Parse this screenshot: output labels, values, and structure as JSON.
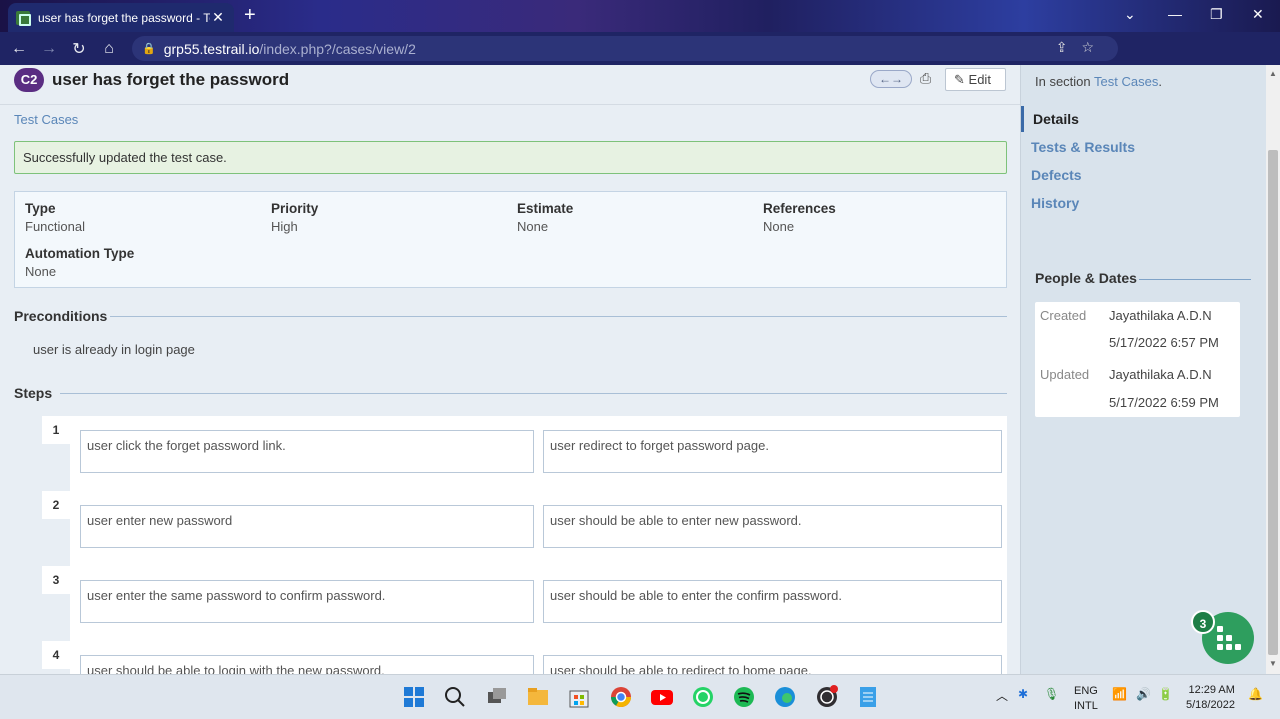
{
  "browser": {
    "tab_title": "user has forget the password - Te",
    "url_host": "grp55.testrail.io",
    "url_path": "/index.php?/cases/view/2"
  },
  "case": {
    "id_badge": "C2",
    "title": "user has forget the password",
    "edit_label": "Edit",
    "breadcrumb": "Test Cases",
    "success_message": "Successfully updated the test case."
  },
  "properties": [
    {
      "label": "Type",
      "value": "Functional"
    },
    {
      "label": "Priority",
      "value": "High"
    },
    {
      "label": "Estimate",
      "value": "None"
    },
    {
      "label": "References",
      "value": "None"
    },
    {
      "label": "Automation Type",
      "value": "None"
    }
  ],
  "preconditions": {
    "heading": "Preconditions",
    "text": "user is already in login page"
  },
  "steps": {
    "heading": "Steps",
    "items": [
      {
        "num": "1",
        "action": "user click the forget password link.",
        "expected": "user redirect to forget password page."
      },
      {
        "num": "2",
        "action": "user enter new password",
        "expected": "user should be able to enter new password."
      },
      {
        "num": "3",
        "action": "user enter the same password to confirm password.",
        "expected": "user should be able to enter the confirm password."
      },
      {
        "num": "4",
        "action": "user should be able to login with the new password.",
        "expected": "user should be able to redirect to home page."
      }
    ]
  },
  "sidebar": {
    "in_section_prefix": "In section",
    "in_section_link": "Test Cases",
    "in_section_suffix": ".",
    "nav": [
      "Details",
      "Tests & Results",
      "Defects",
      "History"
    ],
    "people_dates_title": "People & Dates",
    "created_label": "Created",
    "created_by": "Jayathilaka A.D.N",
    "created_at": "5/17/2022 6:57 PM",
    "updated_label": "Updated",
    "updated_by": "Jayathilaka A.D.N",
    "updated_at": "5/17/2022 6:59 PM"
  },
  "fab": {
    "count": "3"
  },
  "taskbar": {
    "lang_line1": "ENG",
    "lang_line2": "INTL",
    "time": "12:29 AM",
    "date": "5/18/2022"
  },
  "colors": {
    "badge": "#5a2d82",
    "link": "#5a86b8",
    "success_border": "#7ec27a",
    "fab": "#2e9e5e"
  }
}
